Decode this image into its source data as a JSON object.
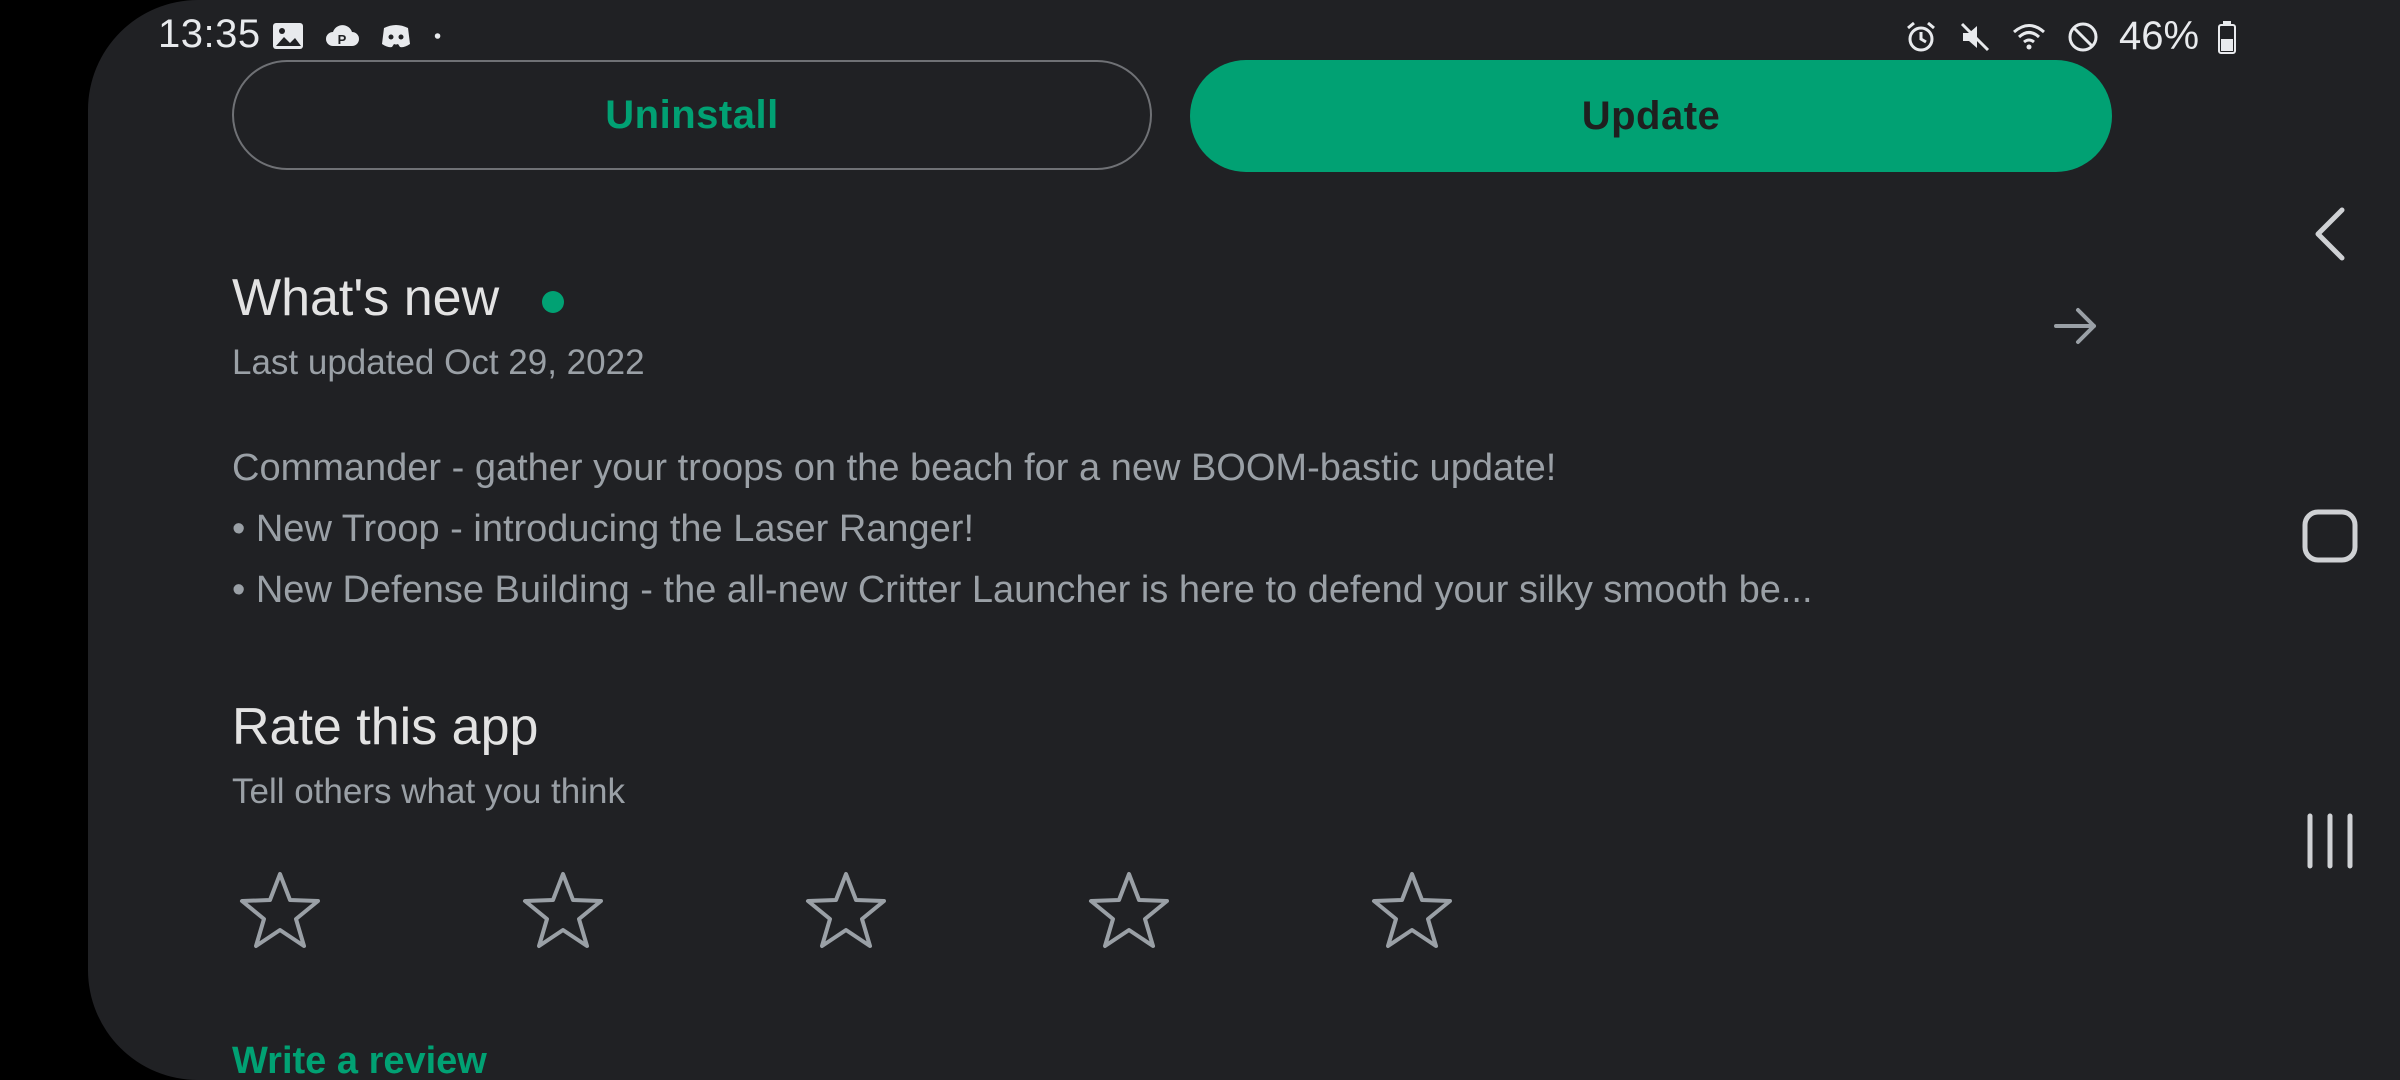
{
  "status_bar": {
    "time": "13:35",
    "battery": "46%",
    "left_icons": [
      "gallery-icon",
      "parking-cloud-icon",
      "discord-icon",
      "dot-icon"
    ],
    "right_icons": [
      "alarm-icon",
      "mute-icon",
      "wifi-icon",
      "do-not-disturb-icon",
      "battery-icon"
    ]
  },
  "actions": {
    "uninstall_label": "Uninstall",
    "update_label": "Update"
  },
  "whats_new": {
    "title": "What's new",
    "last_updated": "Last updated Oct 29, 2022",
    "lines": [
      "Commander - gather your troops on the beach for a new BOOM-bastic update!",
      "• New Troop - introducing the Laser Ranger!",
      "• New Defense Building - the all-new Critter Launcher is here to defend your silky smooth be..."
    ]
  },
  "rate": {
    "title": "Rate this app",
    "subtitle": "Tell others what you think",
    "star_count": 5,
    "write_review_label": "Write a review"
  },
  "colors": {
    "accent": "#01a173",
    "background": "#202124",
    "text_primary": "#e3e3e3",
    "text_secondary": "#9aa0a6"
  },
  "nav_bar": {
    "icons": [
      "back-icon",
      "home-icon",
      "recent-apps-icon"
    ]
  }
}
